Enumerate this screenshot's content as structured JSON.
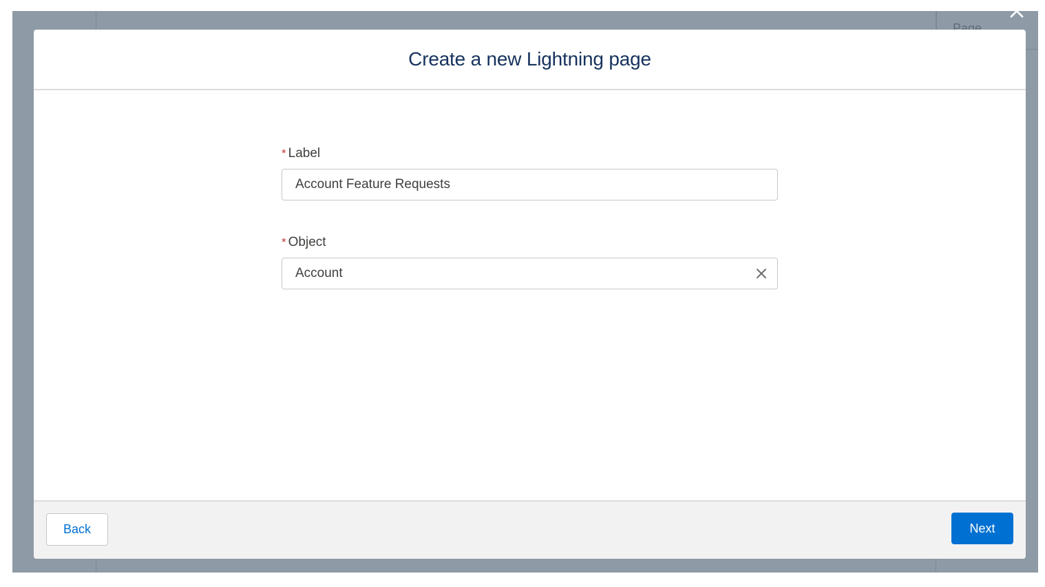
{
  "background": {
    "page_tab_label": "Page"
  },
  "modal": {
    "title": "Create a new Lightning page",
    "fields": {
      "label": {
        "required_mark": "*",
        "label": "Label",
        "value": "Account Feature Requests"
      },
      "object": {
        "required_mark": "*",
        "label": "Object",
        "value": "Account",
        "clear_icon": "close-icon"
      }
    },
    "footer": {
      "back_label": "Back",
      "next_label": "Next"
    }
  },
  "colors": {
    "title": "#16325c",
    "brand_button": "#0070d2",
    "required": "#c23934",
    "overlay": "#8e9aa5"
  }
}
